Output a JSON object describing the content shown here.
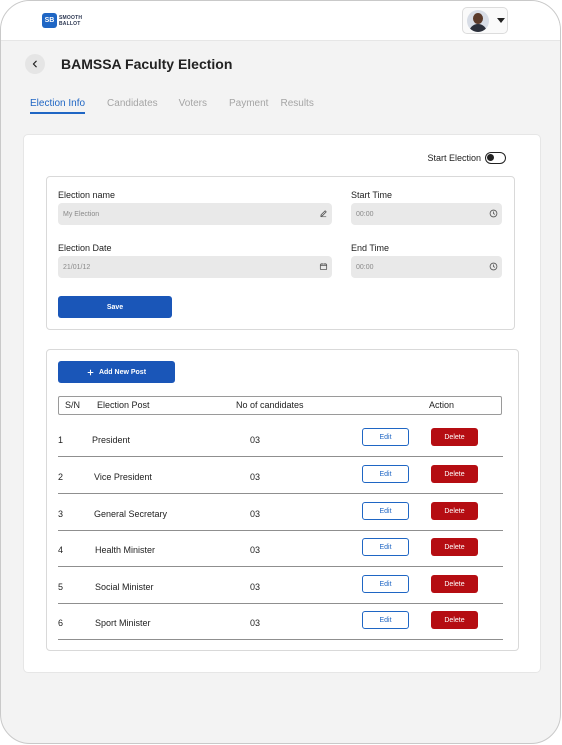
{
  "app": {
    "logo_line1": "SMOOTH",
    "logo_line2": "BALLOT",
    "logo_mark": "SB"
  },
  "colors": {
    "primary": "#1a56b8",
    "active_tab": "#1f66c4",
    "danger": "#b50d12",
    "field_bg": "#e9e9e9"
  },
  "header": {
    "back_icon": "chevron-left-icon",
    "title": "BAMSSA Faculty Election",
    "profile_caret_icon": "caret-down-icon"
  },
  "tabs": [
    {
      "label": "Election Info",
      "active": true
    },
    {
      "label": "Candidates",
      "active": false
    },
    {
      "label": "Voters",
      "active": false
    },
    {
      "label": "Payment",
      "active": false
    },
    {
      "label": "Results",
      "active": false
    }
  ],
  "start_election": {
    "label": "Start Election",
    "enabled": false
  },
  "form": {
    "election_name": {
      "label": "Election name",
      "value": "My Election",
      "icon": "pencil-icon"
    },
    "start_time": {
      "label": "Start Time",
      "value": "00:00",
      "icon": "clock-icon"
    },
    "election_date": {
      "label": "Election Date",
      "value": "21/01/12",
      "icon": "calendar-icon"
    },
    "end_time": {
      "label": "End Time",
      "value": "00:00",
      "icon": "clock-icon"
    },
    "save_label": "Save"
  },
  "posts": {
    "add_label": "Add New Post",
    "add_icon": "plus-icon",
    "columns": [
      "S/N",
      "Election Post",
      "No of candidates",
      "Action"
    ],
    "edit_label": "Edit",
    "delete_label": "Delete",
    "rows": [
      {
        "sn": "1",
        "post": "President",
        "candidates": "03"
      },
      {
        "sn": "2",
        "post": "Vice President",
        "candidates": "03"
      },
      {
        "sn": "3",
        "post": "General Secretary",
        "candidates": "03"
      },
      {
        "sn": "4",
        "post": "Health Minister",
        "candidates": "03"
      },
      {
        "sn": "5",
        "post": "Social Minister",
        "candidates": "03"
      },
      {
        "sn": "6",
        "post": "Sport Minister",
        "candidates": "03"
      }
    ]
  }
}
